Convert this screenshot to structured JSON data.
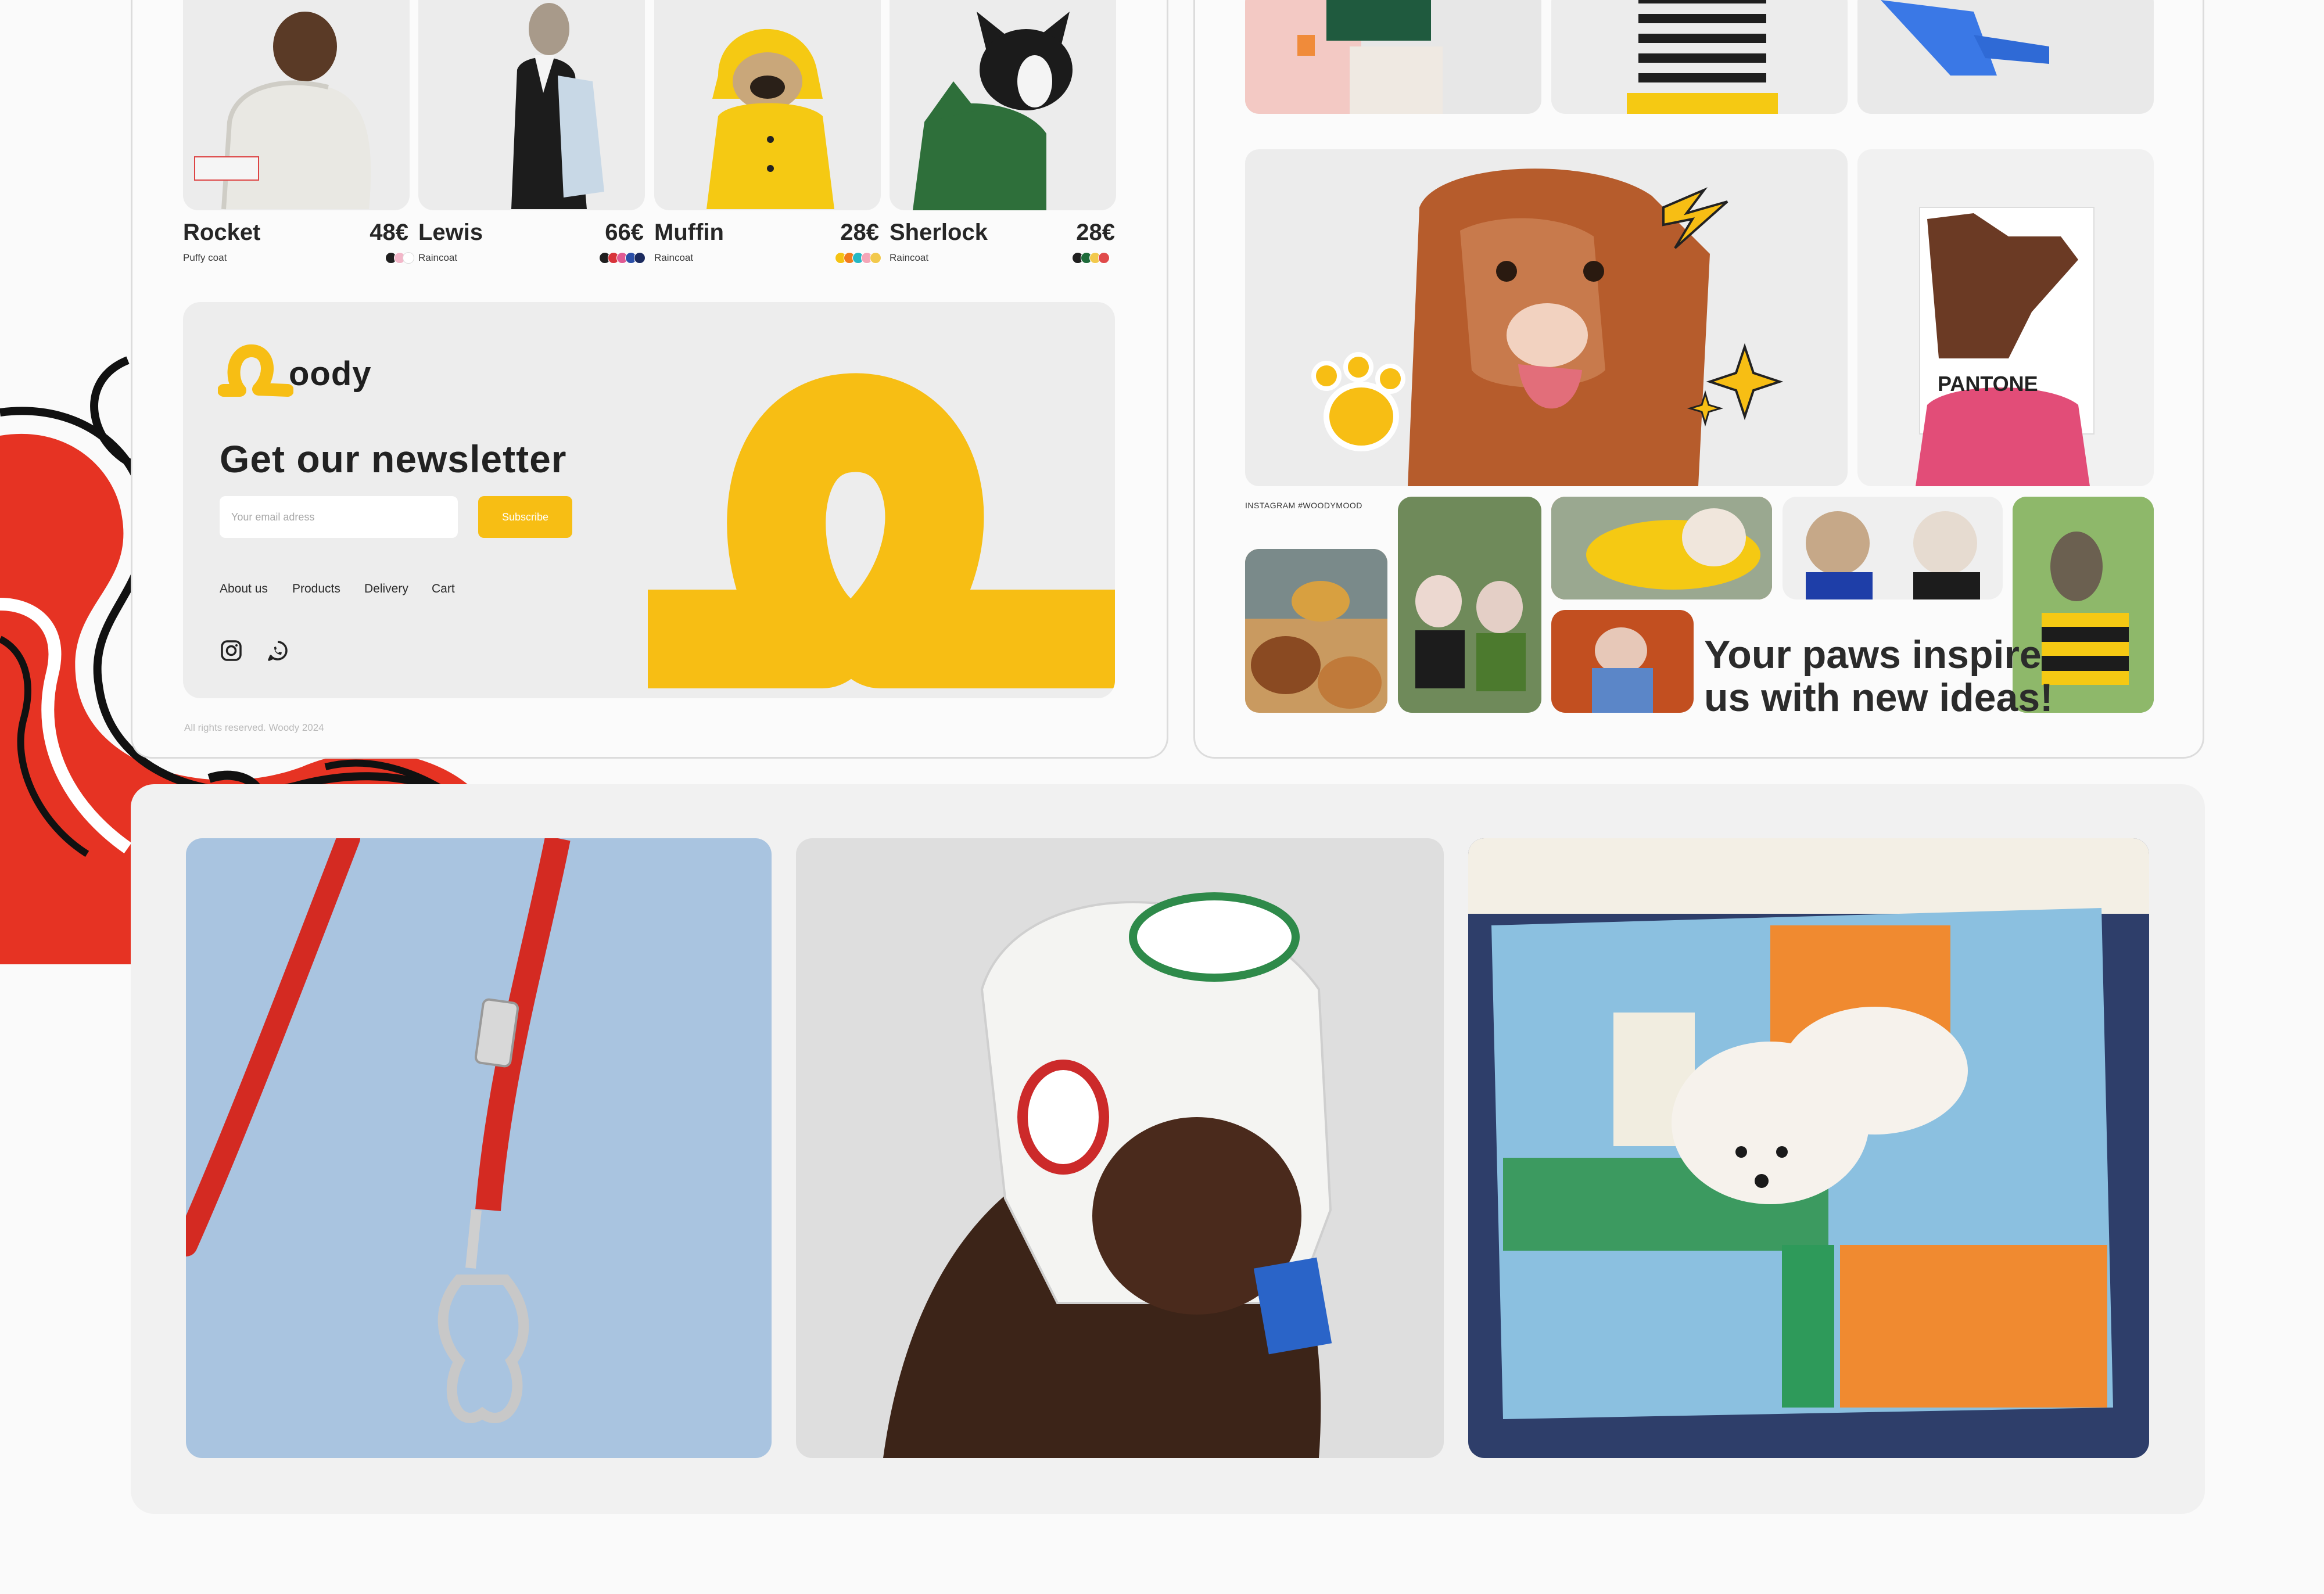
{
  "products": [
    {
      "name": "Rocket",
      "price": "48€",
      "type": "Puffy coat",
      "swatches": [
        "#1f1f1f",
        "#f3b7c9",
        "#ffffff"
      ]
    },
    {
      "name": "Lewis",
      "price": "66€",
      "type": "Raincoat",
      "swatches": [
        "#1f1f1f",
        "#d8343a",
        "#e05a93",
        "#2b4fa8",
        "#1b2a5e"
      ]
    },
    {
      "name": "Muffin",
      "price": "28€",
      "type": "Raincoat",
      "swatches": [
        "#f5c313",
        "#f27b1e",
        "#25b8c4",
        "#f4a6b8",
        "#f2c94c"
      ]
    },
    {
      "name": "Sherlock",
      "price": "28€",
      "type": "Raincoat",
      "swatches": [
        "#1f1f1f",
        "#1e6b3a",
        "#f2c94c",
        "#e04a4a"
      ]
    }
  ],
  "newsletter": {
    "brand": "oody",
    "title": "Get our newsletter",
    "email_placeholder": "Your email adress",
    "subscribe_label": "Subscribe",
    "links": [
      "About us",
      "Products",
      "Delivery",
      "Cart"
    ]
  },
  "copyright": "All rights reserved. Woody 2024",
  "instagram": {
    "tag": "INSTAGRAM #WOODYMOOD",
    "slogan_line1": "Your paws inspire",
    "slogan_line2": "us with new ideas!"
  },
  "pantone_label": "PANTONE",
  "colors": {
    "brand_yellow": "#f7be14",
    "accent_red": "#e63323",
    "card_gray": "#ededed"
  },
  "icons": [
    "instagram-icon",
    "whatsapp-icon"
  ]
}
